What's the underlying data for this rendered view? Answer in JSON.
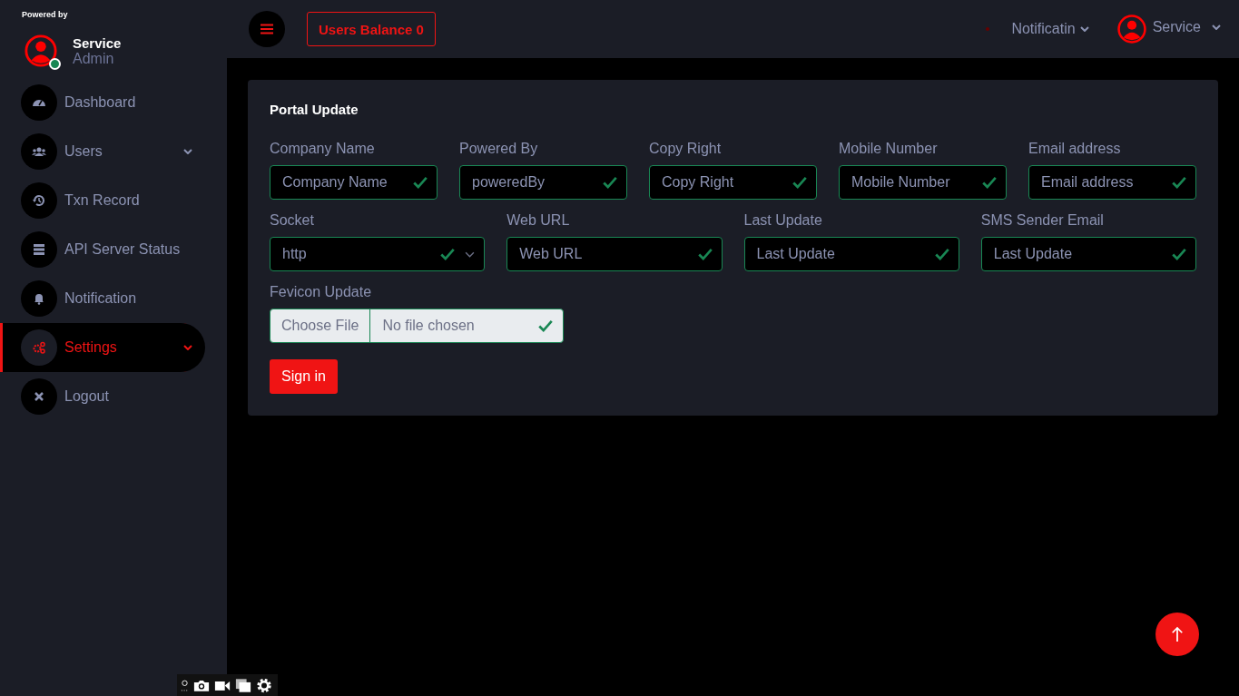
{
  "sidebar": {
    "powered_by": "Powered by",
    "profile": {
      "name": "Service",
      "role": "Admin",
      "online": true
    },
    "items": [
      {
        "label": "Dashboard",
        "selected": false,
        "expandable": false
      },
      {
        "label": "Users",
        "selected": false,
        "expandable": true
      },
      {
        "label": "Txn Record",
        "selected": false,
        "expandable": false
      },
      {
        "label": "API Server Status",
        "selected": false,
        "expandable": false
      },
      {
        "label": "Notification",
        "selected": false,
        "expandable": false
      },
      {
        "label": "Settings",
        "selected": true,
        "expandable": true
      },
      {
        "label": "Logout",
        "selected": false,
        "expandable": false
      }
    ]
  },
  "topbar": {
    "balance": "Users Balance 0",
    "notifications": "Notificatin",
    "user": "Service"
  },
  "form": {
    "title": "Portal Update",
    "rows": [
      {
        "fields": [
          {
            "kind": "text",
            "label": "Company Name",
            "placeholder": "Company Name",
            "valid": true
          },
          {
            "kind": "text",
            "label": "Powered By",
            "value": "poweredBy",
            "valid": true
          },
          {
            "kind": "text",
            "label": "Copy Right",
            "placeholder": "Copy Right",
            "valid": true
          },
          {
            "kind": "text",
            "label": "Mobile Number",
            "placeholder": "Mobile Number",
            "valid": true
          },
          {
            "kind": "text",
            "label": "Email address",
            "placeholder": "Email address",
            "valid": true
          }
        ]
      },
      {
        "fields": [
          {
            "kind": "select",
            "label": "Socket",
            "value": "http",
            "valid": true
          },
          {
            "kind": "text",
            "label": "Web URL",
            "placeholder": "Web URL",
            "valid": true
          },
          {
            "kind": "text",
            "label": "Last Update",
            "placeholder": "Last Update",
            "valid": true
          },
          {
            "kind": "text",
            "label": "SMS Sender Email",
            "placeholder": "Last Update",
            "valid": true
          }
        ]
      },
      {
        "fields": [
          {
            "kind": "file",
            "label": "Fevicon Update",
            "button": "Choose File",
            "value": "No file chosen",
            "valid": true
          }
        ]
      }
    ],
    "submit": "Sign in"
  }
}
